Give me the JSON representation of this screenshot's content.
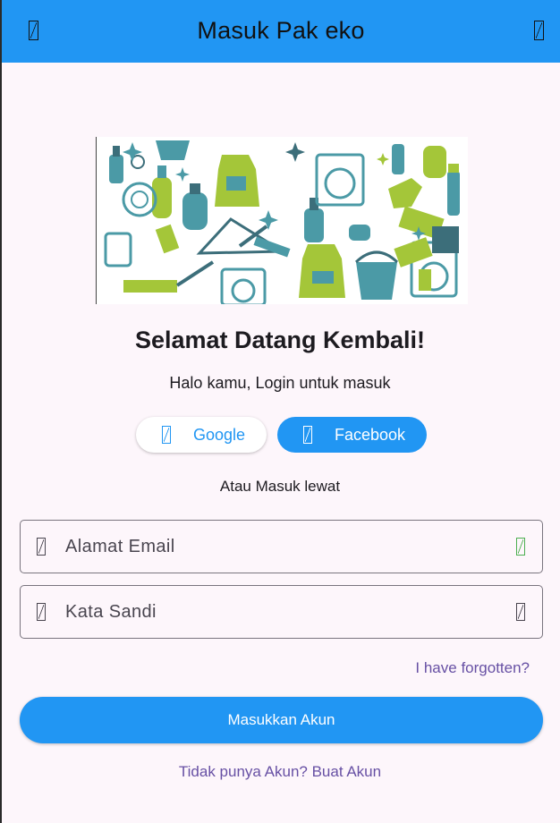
{
  "appbar": {
    "title": "Masuk Pak eko",
    "leading_icon": "menu-icon",
    "trailing_icon": "action-icon"
  },
  "hero": {
    "icon": "cleaning-supplies-illustration",
    "colors": {
      "teal": "#4b9aa6",
      "lime": "#a4c639",
      "dark_teal": "#3c6e7a"
    }
  },
  "welcome": {
    "title": "Selamat Datang Kembali!",
    "subtitle": "Halo kamu, Login untuk masuk"
  },
  "social": {
    "google": {
      "label": "Google",
      "icon": "google-icon"
    },
    "facebook": {
      "label": "Facebook",
      "icon": "facebook-icon"
    },
    "divider_text": "Atau Masuk lewat"
  },
  "form": {
    "email": {
      "placeholder": "Alamat Email",
      "value": "",
      "icon": "email-icon",
      "trailing_icon": "check-icon"
    },
    "password": {
      "placeholder": "Kata Sandi",
      "value": "",
      "icon": "lock-icon",
      "trailing_icon": "visibility-icon"
    },
    "forgot_label": "I have forgotten?",
    "submit_label": "Masukkan Akun",
    "register_label": "Tidak punya Akun? Buat Akun"
  },
  "colors": {
    "primary": "#2196f3",
    "link": "#6750a4",
    "background": "#fdf6fb",
    "valid": "#4caf50"
  }
}
